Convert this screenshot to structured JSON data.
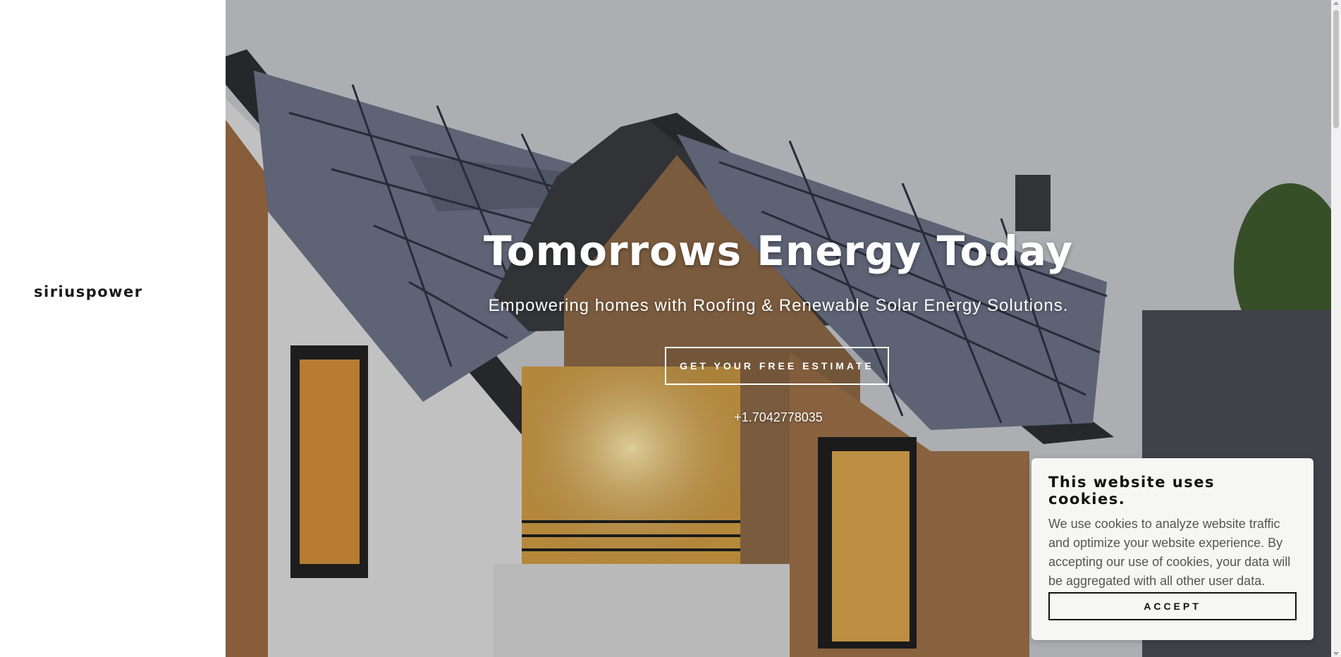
{
  "site": {
    "logo_text": "siriuspower"
  },
  "hero": {
    "title": "Tomorrows Energy Today",
    "subtitle": "Empowering homes with Roofing & Renewable Solar Energy Solutions.",
    "cta_label": "GET YOUR FREE ESTIMATE",
    "phone": "+1.7042778035",
    "background_image": "house-with-solar-roof-photo"
  },
  "cookie_banner": {
    "title": "This website uses cookies.",
    "text": "We use cookies to analyze website traffic and optimize your website experience. By accepting our use of cookies, your data will be aggregated with all other user data.",
    "accept_label": "ACCEPT"
  },
  "colors": {
    "sidebar_bg": "#ffffff",
    "cookie_bg": "#f6f6f4",
    "text_dark": "#111111"
  }
}
